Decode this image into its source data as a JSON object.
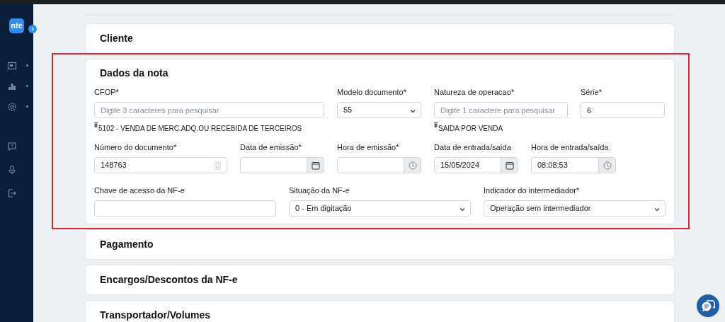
{
  "sidebar": {
    "logo": "nfe",
    "items": [
      {
        "kind": "newspaper",
        "submenu": true
      },
      {
        "kind": "chart",
        "submenu": true
      },
      {
        "kind": "gear",
        "submenu": true
      },
      {
        "kind": "help",
        "submenu": false
      },
      {
        "kind": "mic",
        "submenu": false
      },
      {
        "kind": "logout",
        "submenu": false
      }
    ]
  },
  "sections": [
    {
      "title": "Cliente",
      "kind": "collapsed"
    },
    {
      "title": "Dados da nota",
      "kind": "form",
      "highlighted": true,
      "fields": [
        {
          "label": "CFOP*",
          "kind": "search",
          "placeholder": "Digite 3 caracteres para pesquisar",
          "chosen": "5102 - VENDA DE MERC.ADQ.OU RECEBIDA DE TERCEIROS"
        },
        {
          "label": "Modelo documento*",
          "kind": "select",
          "value": "55"
        },
        {
          "label": "Natureza de operacao*",
          "kind": "search",
          "placeholder": "Digite 1 caractere para pesquisar",
          "chosen": "SAIDA POR VENDA"
        },
        {
          "label": "Série*",
          "kind": "text",
          "value": "6"
        },
        {
          "label": "Número do documento*",
          "kind": "number",
          "value": "148763"
        },
        {
          "label": "Data de emissão*",
          "kind": "date"
        },
        {
          "label": "Hora de emissão*",
          "kind": "time"
        },
        {
          "label": "Data de entrada/saída",
          "kind": "date",
          "value": "15/05/2024"
        },
        {
          "label": "Hora de entrada/saída",
          "kind": "time",
          "value": "08:08:53"
        },
        {
          "label": "Chave de acesso da NF-e",
          "kind": "text"
        },
        {
          "label": "Situação da NF-e",
          "kind": "select",
          "value": "0 - Em digitação"
        },
        {
          "label": "Indicador do intermediador*",
          "kind": "select",
          "value": "Operação sem intermediador"
        }
      ]
    },
    {
      "title": "Pagamento",
      "kind": "collapsed"
    },
    {
      "title": "Encargos/Descontos da NF-e",
      "kind": "collapsed"
    },
    {
      "title": "Transportador/Volumes",
      "kind": "collapsed"
    }
  ]
}
